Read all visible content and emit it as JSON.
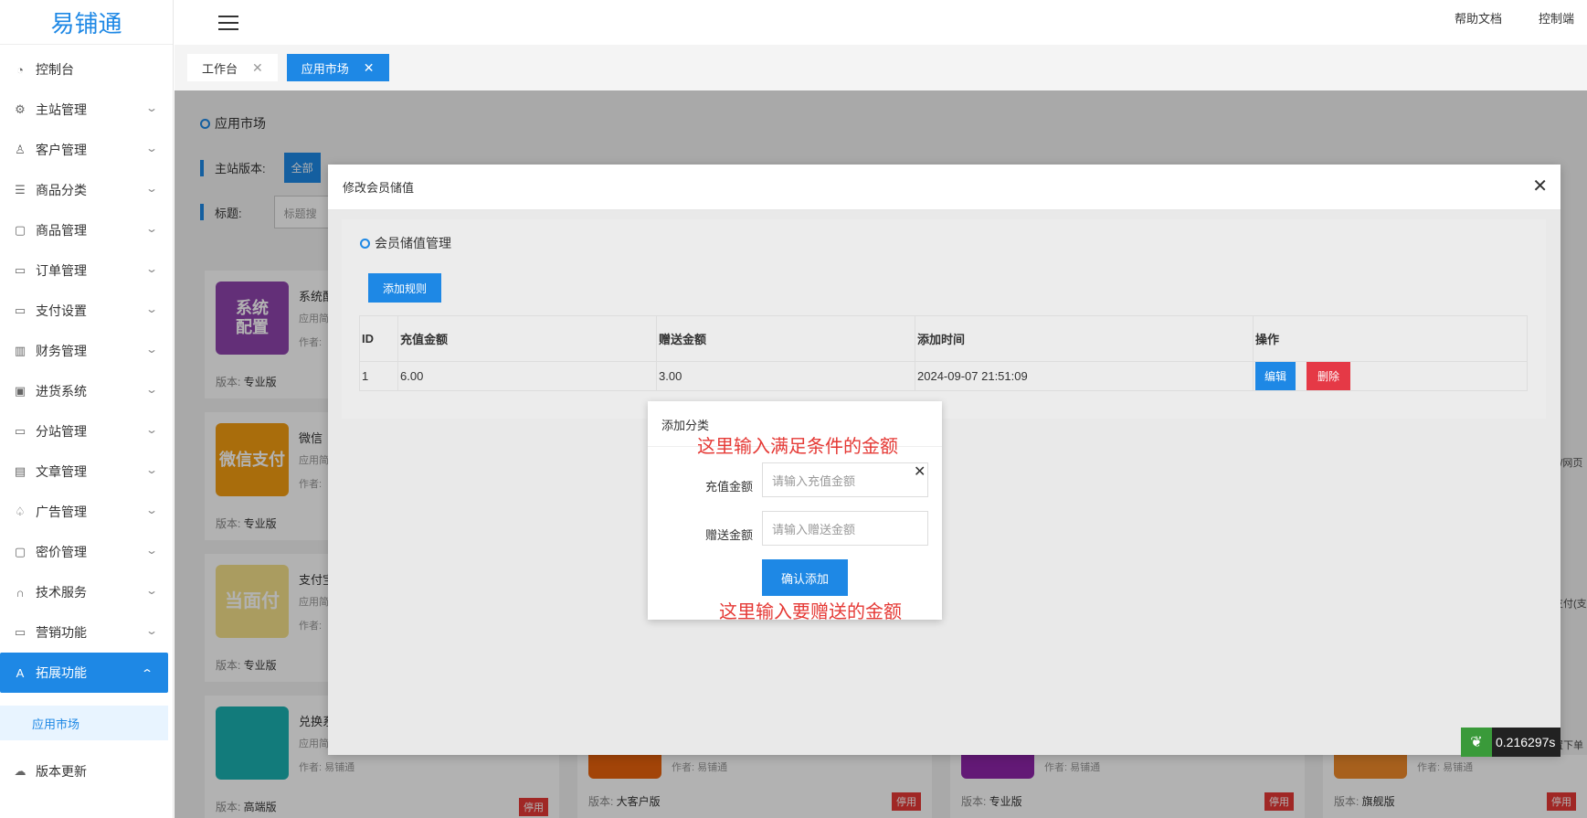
{
  "app": {
    "logo": "易铺通"
  },
  "header": {
    "help_docs": "帮助文档",
    "console": "控制端"
  },
  "sidebar": {
    "items": [
      {
        "label": "控制台",
        "icon": "dashboard-icon",
        "glyph": "◔",
        "arrow": false
      },
      {
        "label": "主站管理",
        "icon": "gear-icon",
        "glyph": "⚙",
        "arrow": true
      },
      {
        "label": "客户管理",
        "icon": "user-icon",
        "glyph": "♙",
        "arrow": true
      },
      {
        "label": "商品分类",
        "icon": "list-icon",
        "glyph": "☰",
        "arrow": true
      },
      {
        "label": "商品管理",
        "icon": "bag-icon",
        "glyph": "▢",
        "arrow": true
      },
      {
        "label": "订单管理",
        "icon": "clipboard-icon",
        "glyph": "▭",
        "arrow": true
      },
      {
        "label": "支付设置",
        "icon": "wallet-icon",
        "glyph": "▭",
        "arrow": true
      },
      {
        "label": "财务管理",
        "icon": "bar-chart-icon",
        "glyph": "▥",
        "arrow": true
      },
      {
        "label": "进货系统",
        "icon": "box-icon",
        "glyph": "▣",
        "arrow": true
      },
      {
        "label": "分站管理",
        "icon": "monitor-icon",
        "glyph": "▭",
        "arrow": true
      },
      {
        "label": "文章管理",
        "icon": "article-icon",
        "glyph": "▤",
        "arrow": true
      },
      {
        "label": "广告管理",
        "icon": "megaphone-icon",
        "glyph": "♤",
        "arrow": true
      },
      {
        "label": "密价管理",
        "icon": "lock-bag-icon",
        "glyph": "▢",
        "arrow": true
      },
      {
        "label": "技术服务",
        "icon": "headset-icon",
        "glyph": "∩",
        "arrow": true
      },
      {
        "label": "营销功能",
        "icon": "screen-icon",
        "glyph": "▭",
        "arrow": true
      }
    ],
    "active": {
      "label": "拓展功能",
      "icon": "rocket-icon",
      "glyph": "A"
    },
    "submenu": "应用市场",
    "update": {
      "label": "版本更新",
      "icon": "cloud-upload-icon",
      "glyph": "☁"
    }
  },
  "tabs": [
    {
      "label": "工作台",
      "close": "✕"
    },
    {
      "label": "应用市场",
      "close": "✕"
    }
  ],
  "main": {
    "title": "应用市场",
    "version_label": "主站版本:",
    "version_btn": "全部",
    "title_label": "标题:",
    "title_input": "标题搜"
  },
  "cards": [
    {
      "thumb": "系统\n配置",
      "color": "#8e44ad",
      "title": "系统配",
      "desc": "应用简",
      "author": "作者:",
      "ver_label": "版本:",
      "ver": "专业版",
      "stop": ""
    },
    {
      "thumb": "微信支付",
      "color": "#f39c12",
      "title": "微信",
      "desc": "应用简",
      "author": "作者:",
      "ver_label": "版本:",
      "ver": "专业版",
      "stop": ""
    },
    {
      "thumb": "当面付",
      "color": "#f4e08a",
      "title": "支付宝",
      "desc": "应用简",
      "author": "作者:",
      "ver_label": "版本:",
      "ver": "专业版",
      "stop": ""
    },
    {
      "thumb": "",
      "color": "#1ab0b0",
      "title": "兑换系",
      "desc": "应用简",
      "author": "作者: 易铺通",
      "ver_label": "版本:",
      "ver": "高端版",
      "stop": "停用"
    }
  ],
  "bottom_cards": [
    {
      "author": "作者: 易铺通",
      "ver_label": "版本:",
      "ver": "大客户版",
      "stop": "停用"
    },
    {
      "author": "作者: 易铺通",
      "ver_label": "版本:",
      "ver": "专业版",
      "stop": "停用"
    },
    {
      "author": "作者: 易铺通",
      "ver_label": "版本:",
      "ver": "旗舰版",
      "stop": "停用"
    }
  ],
  "side_snippets": [
    "P/网页",
    "支付(支",
    "置下单"
  ],
  "modal": {
    "title": "修改会员储值",
    "close": "✕",
    "section_title": "会员储值管理",
    "add_rule": "添加规则",
    "table": {
      "headers": [
        "ID",
        "充值金额",
        "赠送金额",
        "添加时间",
        "操作"
      ],
      "rows": [
        {
          "id": "1",
          "recharge": "6.00",
          "bonus": "3.00",
          "time": "2024-09-07 21:51:09",
          "edit": "编辑",
          "delete": "删除"
        }
      ]
    }
  },
  "dialog": {
    "title": "添加分类",
    "close": "✕",
    "recharge_label": "充值金额",
    "recharge_placeholder": "请输入充值金额",
    "bonus_label": "赠送金额",
    "bonus_placeholder": "请输入赠送金额",
    "confirm": "确认添加",
    "annotation_top": "这里输入满足条件的金额",
    "annotation_bottom": "这里输入要赠送的金额"
  },
  "timer": "0.216297s"
}
